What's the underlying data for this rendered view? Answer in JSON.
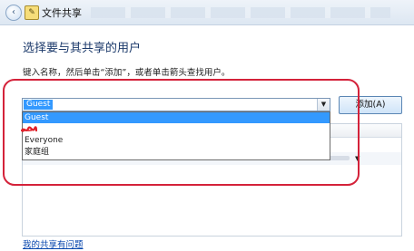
{
  "window": {
    "title": "文件共享",
    "back_glyph": "‹",
    "share_glyph": "✎"
  },
  "heading": "选择要与其共享的用户",
  "instruction": "键入名称，然后单击“添加”，或者单击箭头查找用户。",
  "combo": {
    "value": "Guest",
    "arrow_glyph": "▼",
    "options": [
      "Guest",
      "",
      "Everyone",
      "家庭组"
    ],
    "selected_index": 0
  },
  "add_button_label": "添加(A)",
  "table": {
    "row_arrow_glyph": "▼"
  },
  "help_link": "我的共享有问题",
  "colors": {
    "accent": "#3399ff",
    "annotation": "#d4223a",
    "scribble": "#e0202a",
    "heading": "#1c3a6b",
    "link": "#0645ad"
  }
}
